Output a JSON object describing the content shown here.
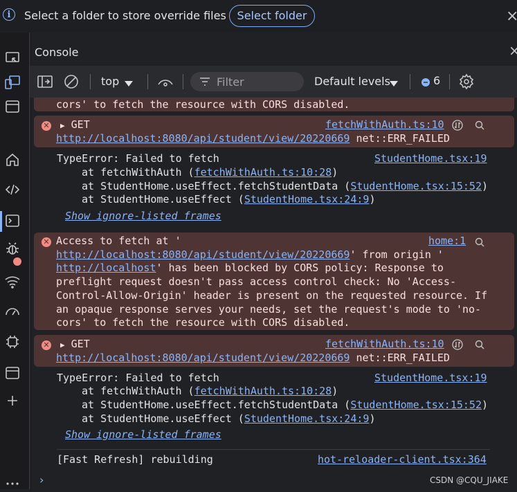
{
  "infobar": {
    "message": "Select a folder to store override files in.",
    "select_folder_label": "Select folder",
    "close": "×"
  },
  "header": {
    "title": "Console",
    "close": "×"
  },
  "toolbar": {
    "context": "top",
    "filter_placeholder": "Filter",
    "levels": "Default levels",
    "message_count": "6"
  },
  "log": {
    "partial_top": "cors' to fetch the resource with CORS disabled.",
    "block1": {
      "method": "GET",
      "source": "fetchWithAuth.ts:10",
      "url": "http://localhost:8080/api/student/view/20220669",
      "status": "net::ERR_FAILED"
    },
    "trace1": {
      "message": "TypeError: Failed to fetch",
      "source": "StudentHome.tsx:19",
      "frames": [
        {
          "prefix": "at fetchWithAuth (",
          "link": "fetchWithAuth.ts:10:28",
          "suffix": ")"
        },
        {
          "prefix": "at StudentHome.useEffect.fetchStudentData (",
          "link": "StudentHome.tsx:15:52",
          "suffix": ")"
        },
        {
          "prefix": "at StudentHome.useEffect (",
          "link": "StudentHome.tsx:24:9",
          "suffix": ")"
        }
      ],
      "show_ignored": "Show ignore-listed frames"
    },
    "cors": {
      "source": "home:1",
      "l1": "Access to fetch at '",
      "url": "http://localhost:8080/api/student/view/20220669",
      "l2_suffix": "' from origin '",
      "origin": "http://localhost",
      "l3_suffix": "' has been blocked by CORS policy: Response to",
      "l4": "preflight request doesn't pass access control check: No 'Access-",
      "l5": "Control-Allow-Origin' header is present on the requested resource. If",
      "l6": "an opaque response serves your needs, set the request's mode to 'no-",
      "l7": "cors' to fetch the resource with CORS disabled."
    },
    "block2": {
      "method": "GET",
      "source": "fetchWithAuth.ts:10",
      "url": "http://localhost:8080/api/student/view/20220669",
      "status": "net::ERR_FAILED"
    },
    "trace2": {
      "message": "TypeError: Failed to fetch",
      "source": "StudentHome.tsx:19",
      "frames": [
        {
          "prefix": "at fetchWithAuth (",
          "link": "fetchWithAuth.ts:10:28",
          "suffix": ")"
        },
        {
          "prefix": "at StudentHome.useEffect.fetchStudentData (",
          "link": "StudentHome.tsx:15:52",
          "suffix": ")"
        },
        {
          "prefix": "at StudentHome.useEffect (",
          "link": "StudentHome.tsx:24:9",
          "suffix": ")"
        }
      ],
      "show_ignored": "Show ignore-listed frames"
    },
    "refresh": {
      "message": "[Fast Refresh] rebuilding",
      "source": "hot-reloader-client.tsx:364"
    }
  },
  "prompt": "›",
  "watermark": "CSDN @CQU_JIAKE"
}
